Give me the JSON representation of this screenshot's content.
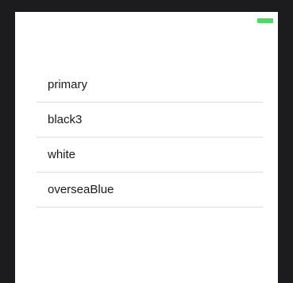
{
  "status_bar": {
    "battery_icon": "battery-icon",
    "battery_color": "#4cd964"
  },
  "list": {
    "items": [
      {
        "label": "primary"
      },
      {
        "label": "black3"
      },
      {
        "label": "white"
      },
      {
        "label": "overseaBlue"
      }
    ]
  }
}
